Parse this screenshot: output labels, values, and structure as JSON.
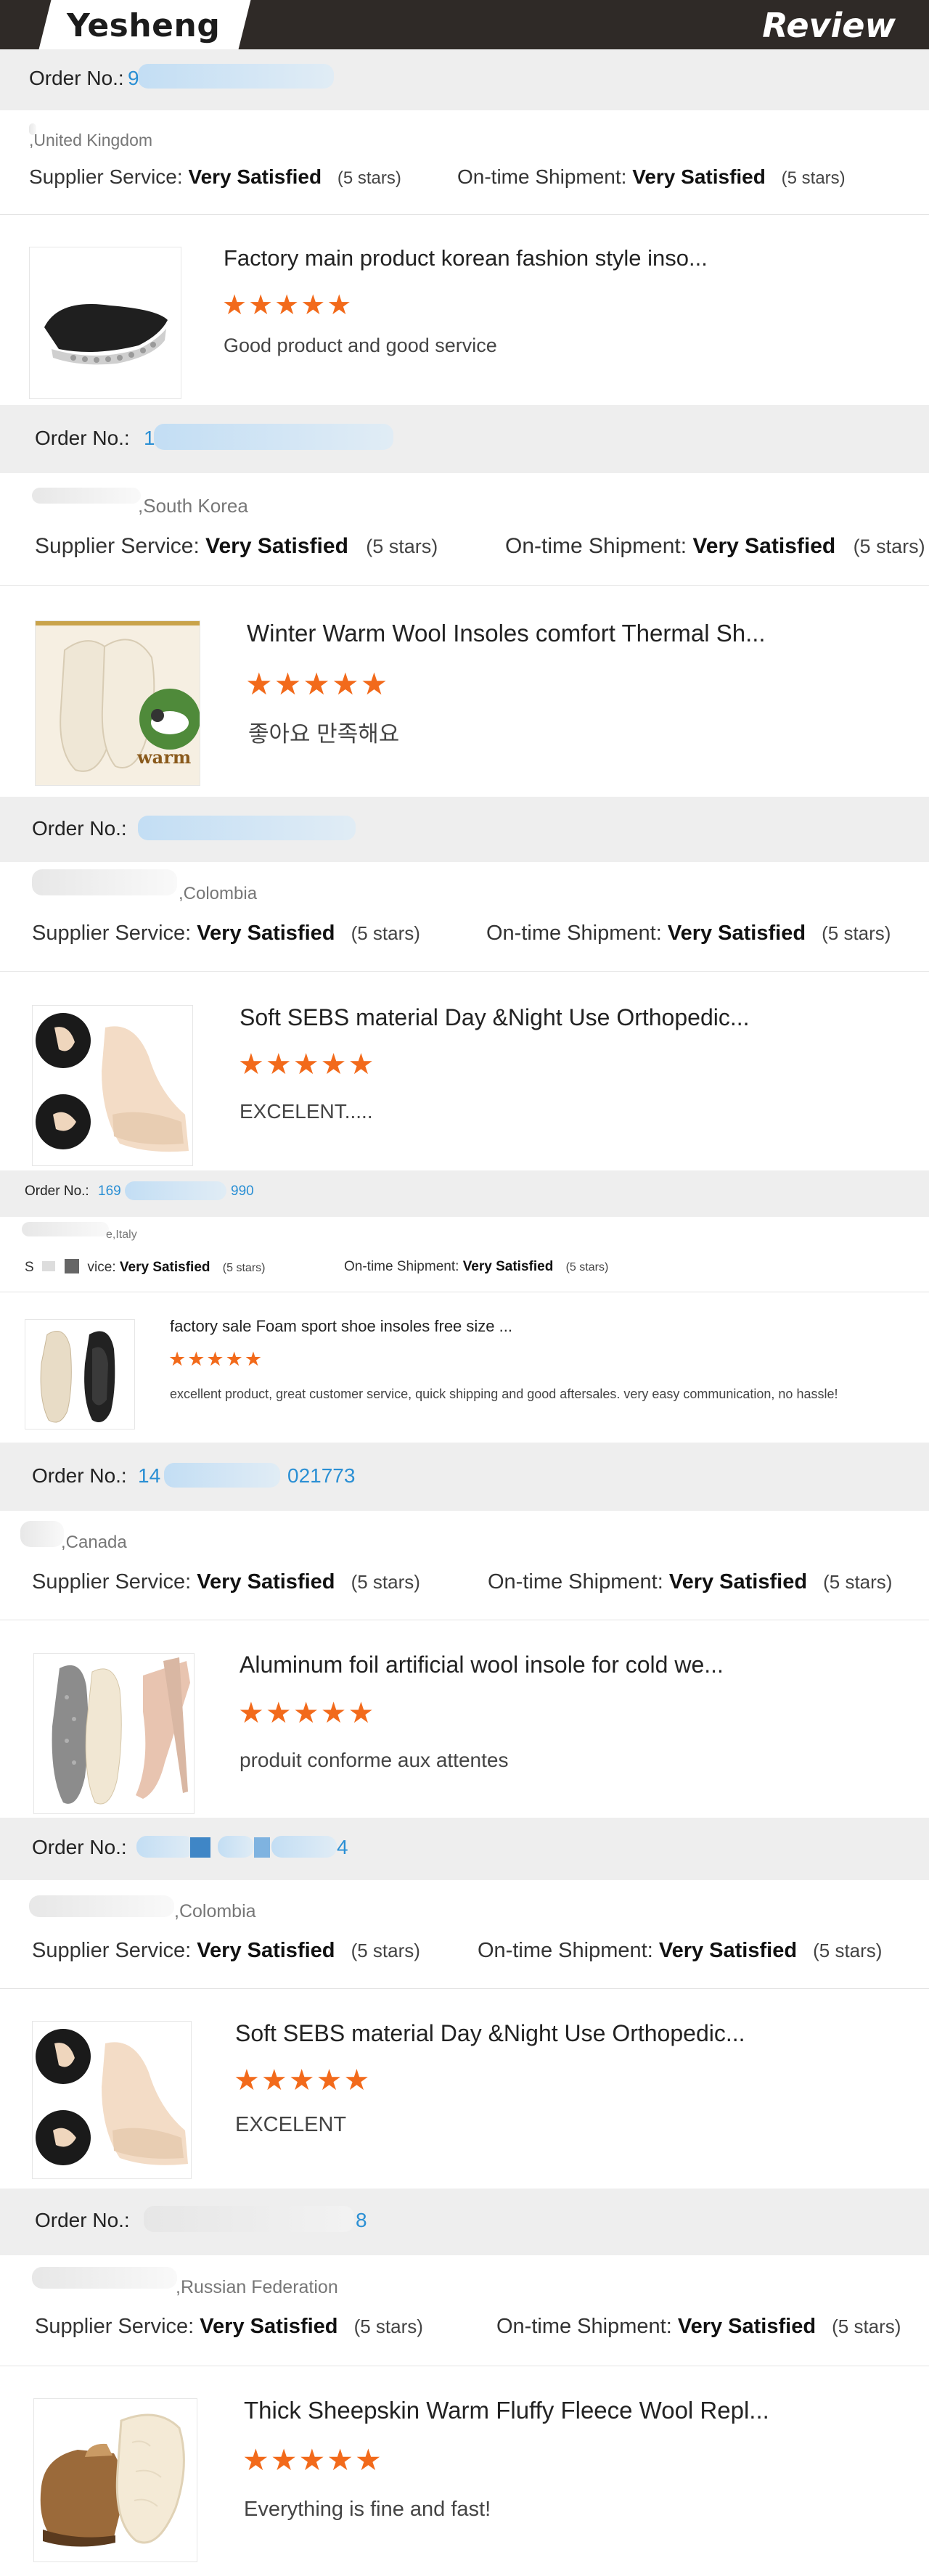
{
  "header": {
    "brand": "Yesheng",
    "title": "Review"
  },
  "labels": {
    "order_no": "Order No.:",
    "supplier_service": "Supplier Service:",
    "on_time_shipment": "On-time Shipment:",
    "rating_text": "Very Satisfied",
    "stars_note": "(5 stars)",
    "star_glyphs": "★★★★★"
  },
  "reviews": [
    {
      "order_no": "9",
      "country": ",United Kingdom",
      "product_title": "Factory main product korean fashion style inso...",
      "comment": "Good product and good service"
    },
    {
      "order_no": "1",
      "country": ",South Korea",
      "product_title": "Winter Warm Wool Insoles comfort Thermal Sh...",
      "comment": "좋아요 만족해요",
      "thumb_text": "warm"
    },
    {
      "order_no": "",
      "country": ",Colombia",
      "product_title": "Soft SEBS material Day &Night Use Orthopedic...",
      "comment": "EXCELENT....."
    },
    {
      "order_no_a": "169",
      "order_no_b": "990",
      "country": "e,Italy",
      "supplier_prefix": "S",
      "supplier_suffix": "vice:",
      "product_title": "factory sale Foam sport shoe insoles free size ...",
      "comment": "excellent product, great customer service, quick shipping and good aftersales. very easy communication, no hassle!"
    },
    {
      "order_no_a": "14",
      "order_no_b": "021773",
      "country": ",Canada",
      "product_title": "Aluminum foil artificial wool insole for cold we...",
      "comment": "produit conforme aux attentes"
    },
    {
      "order_no": "4",
      "country": ",Colombia",
      "product_title": "Soft SEBS material Day &Night Use Orthopedic...",
      "comment": "EXCELENT"
    },
    {
      "order_no": "8",
      "country": ",Russian Federation",
      "product_title": "Thick Sheepskin Warm Fluffy Fleece Wool Repl...",
      "comment": "Everything is fine and fast!"
    }
  ],
  "colors": {
    "header_bg": "#2f2a27",
    "order_bar": "#eeeeee",
    "order_link": "#2a8fd4",
    "star": "#f26a1b"
  }
}
